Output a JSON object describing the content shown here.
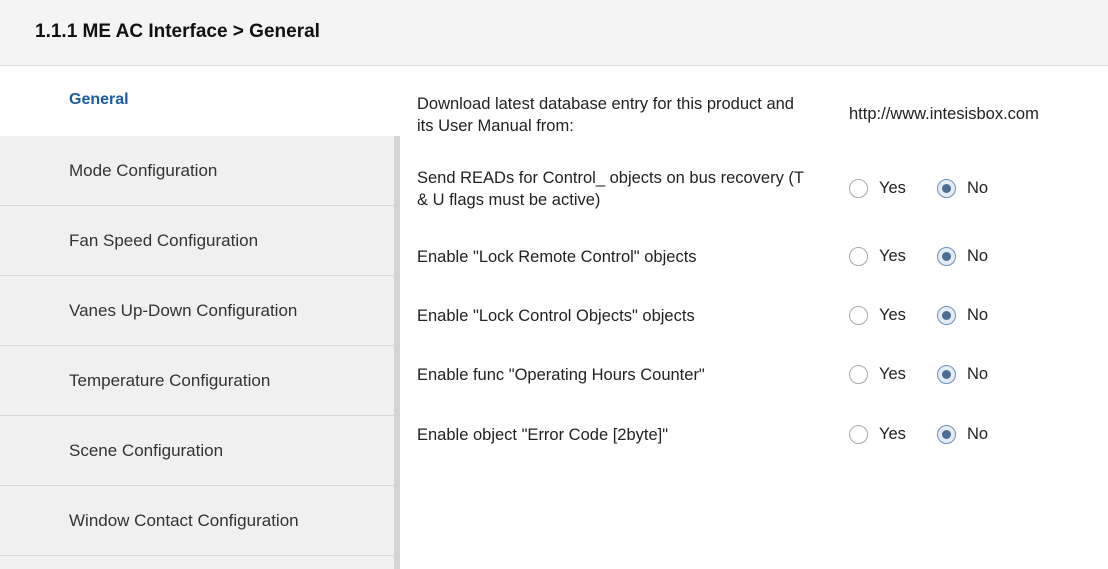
{
  "header": {
    "title": "1.1.1 ME AC Interface > General"
  },
  "sidebar": {
    "items": [
      {
        "label": "General",
        "active": true
      },
      {
        "label": "Mode Configuration",
        "active": false
      },
      {
        "label": "Fan Speed Configuration",
        "active": false
      },
      {
        "label": "Vanes Up-Down Configuration",
        "active": false
      },
      {
        "label": "Temperature Configuration",
        "active": false
      },
      {
        "label": "Scene Configuration",
        "active": false
      },
      {
        "label": "Window Contact Configuration",
        "active": false
      }
    ]
  },
  "params": {
    "download": {
      "label": "Download latest database entry for this product and its User Manual from:",
      "value": "http://www.intesisbox.com"
    },
    "send_reads": {
      "label": "Send READs for Control_ objects on bus recovery (T & U flags must be active)",
      "yes": "Yes",
      "no": "No",
      "selected": "No"
    },
    "lock_remote": {
      "label": "Enable \"Lock Remote Control\" objects",
      "yes": "Yes",
      "no": "No",
      "selected": "No"
    },
    "lock_control": {
      "label": "Enable \"Lock Control Objects\" objects",
      "yes": "Yes",
      "no": "No",
      "selected": "No"
    },
    "op_hours": {
      "label": "Enable func \"Operating Hours Counter\"",
      "yes": "Yes",
      "no": "No",
      "selected": "No"
    },
    "error_code": {
      "label": "Enable object \"Error Code [2byte]\"",
      "yes": "Yes",
      "no": "No",
      "selected": "No"
    }
  },
  "colors": {
    "active_nav": "#1a5aa6",
    "sidebar_bg": "#f0f0f0",
    "header_bg": "#f4f4f4"
  }
}
